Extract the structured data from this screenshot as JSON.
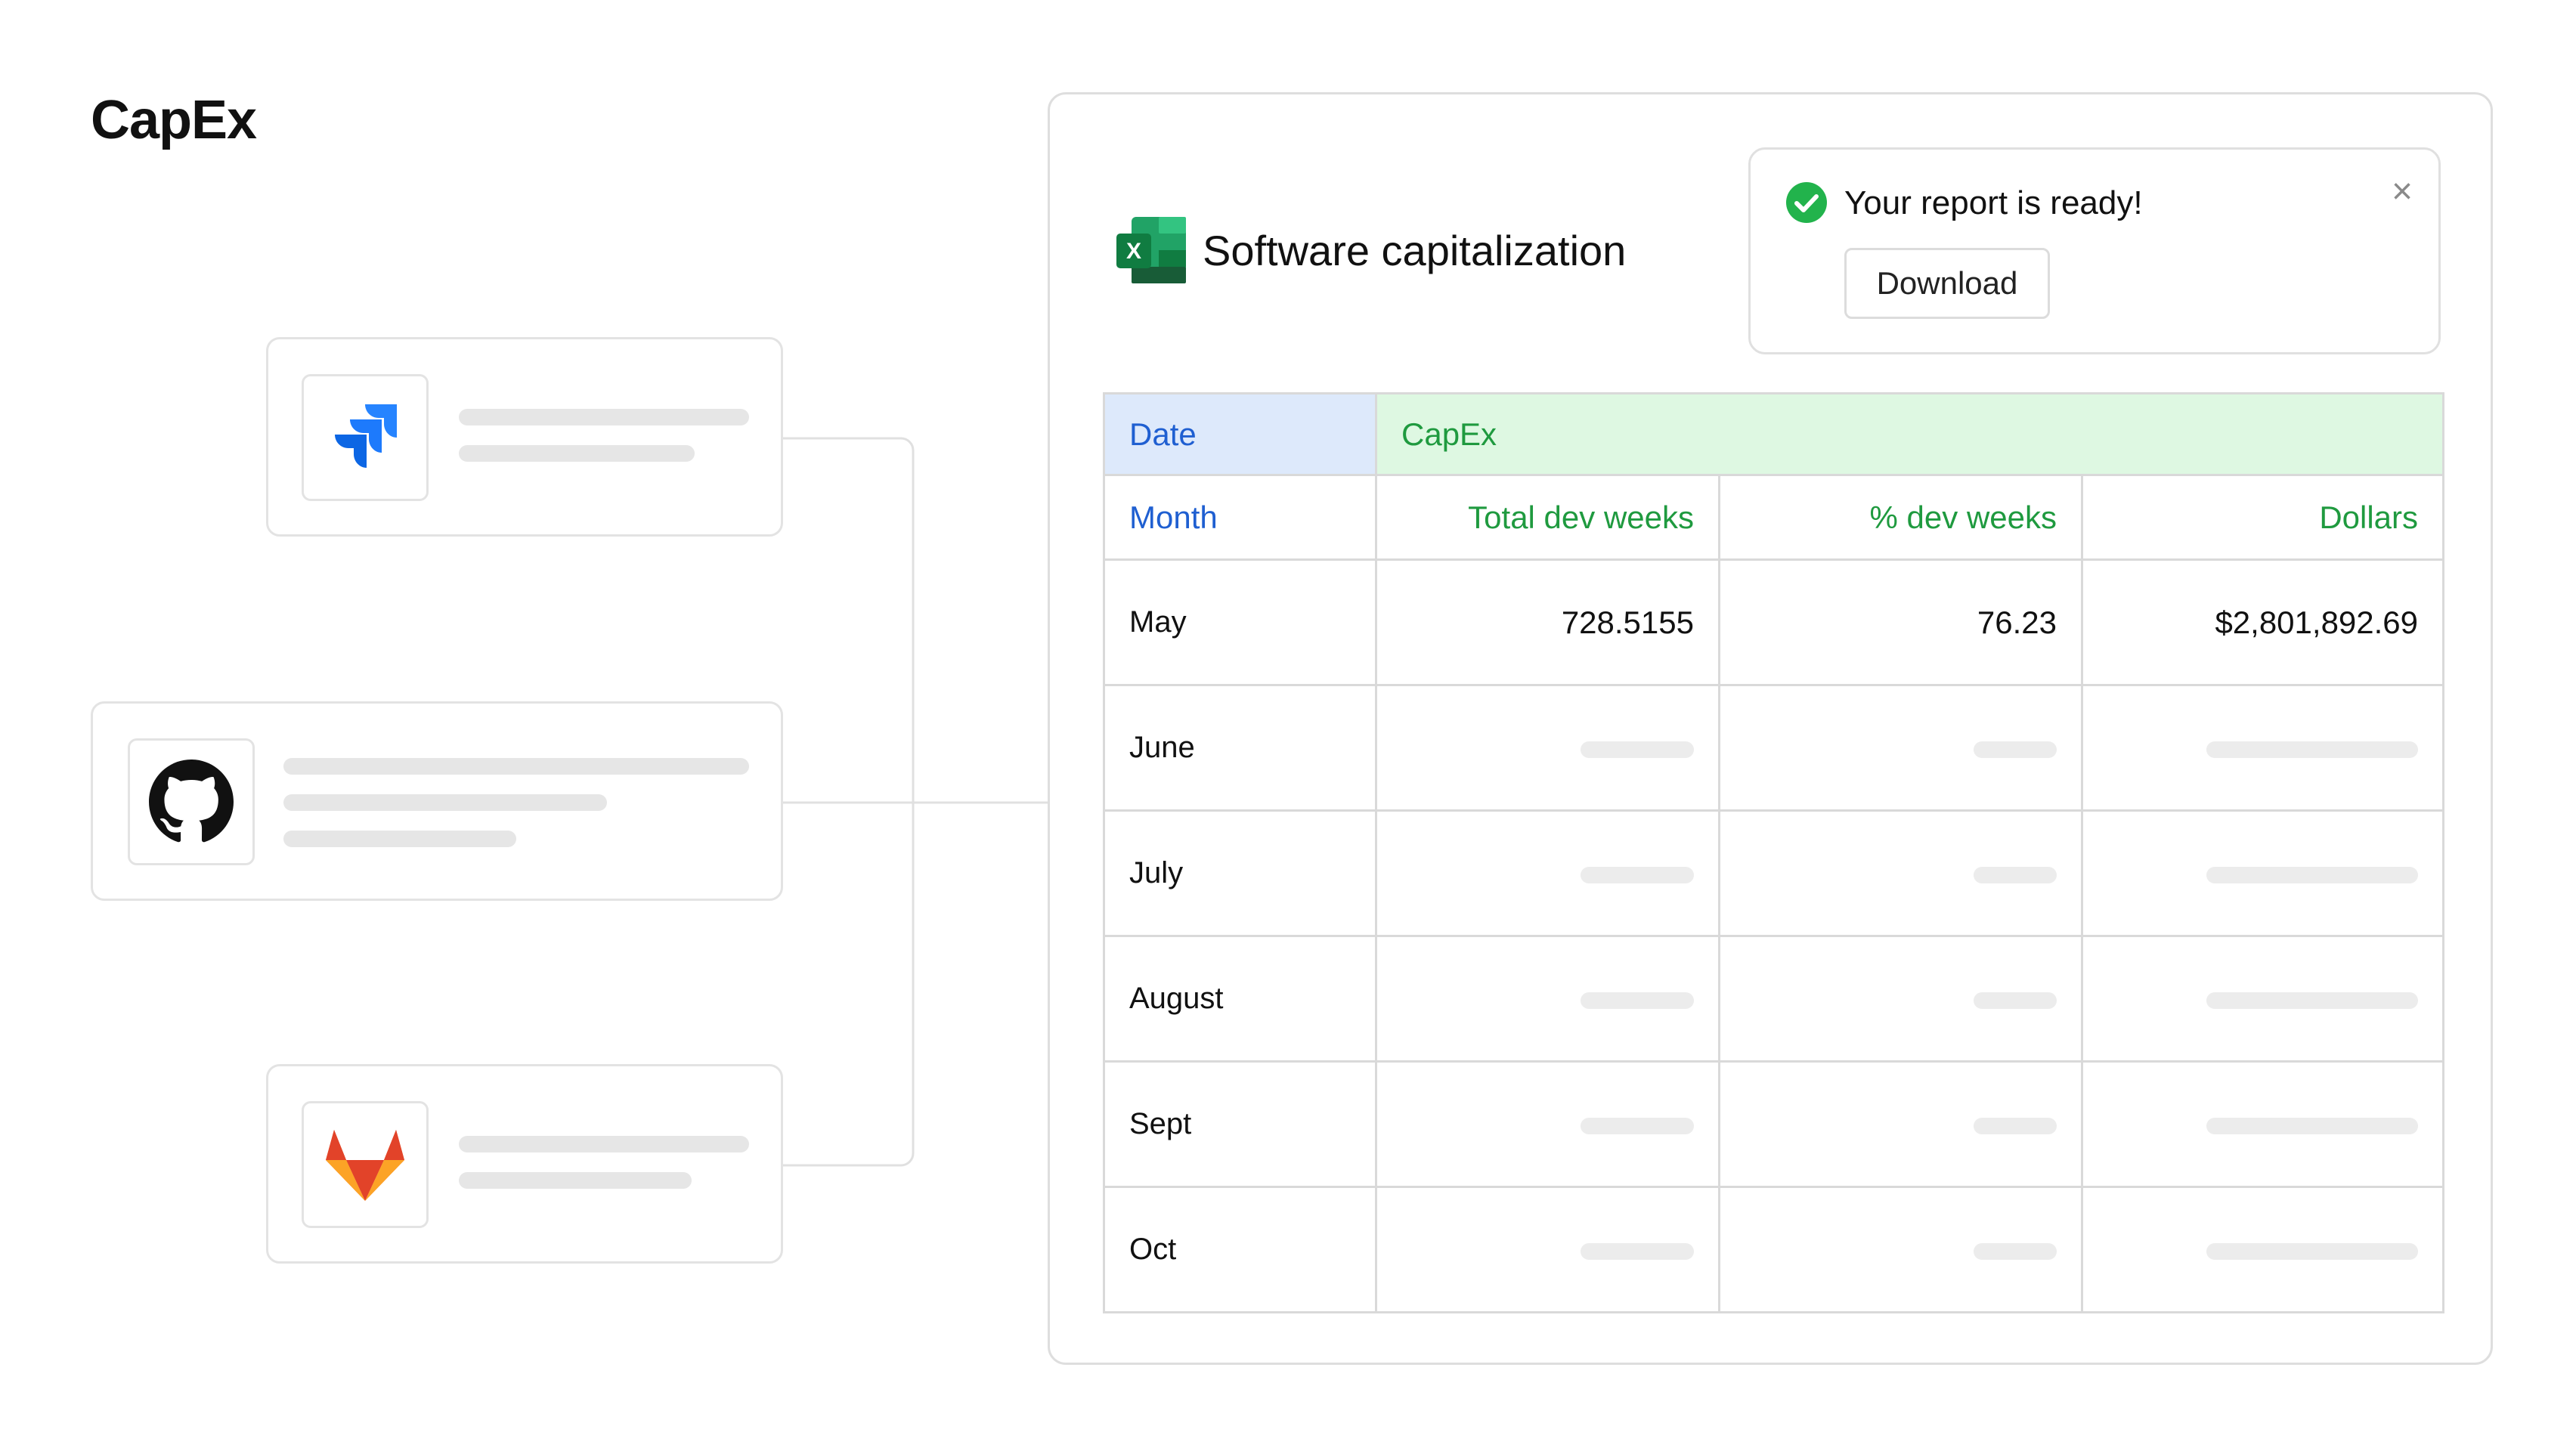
{
  "page": {
    "title": "CapEx"
  },
  "sources": [
    {
      "name": "jira",
      "icon": "jira-icon"
    },
    {
      "name": "github",
      "icon": "github-icon"
    },
    {
      "name": "gitlab",
      "icon": "gitlab-icon"
    }
  ],
  "report": {
    "title": "Software capitalization",
    "icon": "excel-icon",
    "toast": {
      "message": "Your report is ready!",
      "download_label": "Download",
      "close_icon": "close-icon",
      "status_icon": "check-circle-icon"
    },
    "table": {
      "group_headers": {
        "date": "Date",
        "capex": "CapEx"
      },
      "columns": [
        "Month",
        "Total dev weeks",
        "% dev weeks",
        "Dollars"
      ],
      "rows": [
        {
          "month": "May",
          "total_dev_weeks": "728.5155",
          "pct_dev_weeks": "76.23",
          "dollars": "$2,801,892.69"
        },
        {
          "month": "June"
        },
        {
          "month": "July"
        },
        {
          "month": "August"
        },
        {
          "month": "Sept"
        },
        {
          "month": "Oct"
        }
      ]
    }
  },
  "colors": {
    "date_header_bg": "#dde9fb",
    "date_text": "#1f5fd1",
    "capex_header_bg": "#def8e2",
    "capex_text": "#1f9a3f",
    "success": "#22b34c"
  }
}
